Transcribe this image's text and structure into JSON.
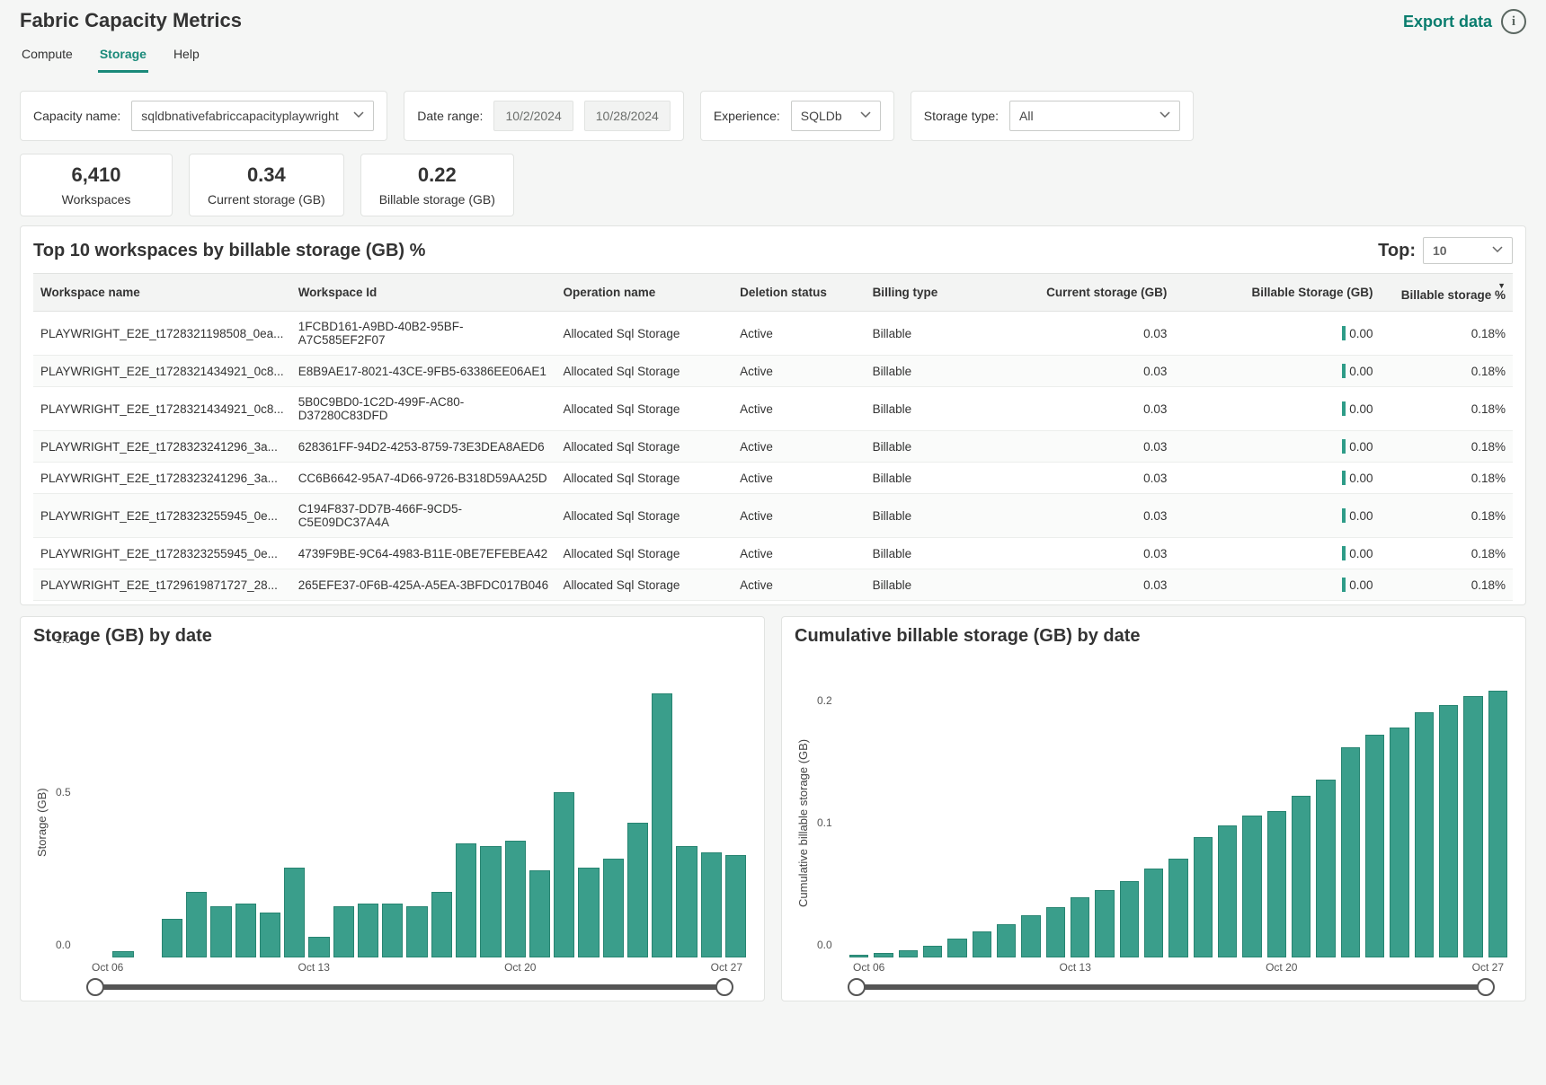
{
  "header": {
    "title": "Fabric Capacity Metrics",
    "export_label": "Export data"
  },
  "tabs": [
    {
      "label": "Compute",
      "active": false
    },
    {
      "label": "Storage",
      "active": true
    },
    {
      "label": "Help",
      "active": false
    }
  ],
  "filters": {
    "capacity_label": "Capacity name:",
    "capacity_value": "sqldbnativefabriccapacityplaywright",
    "date_label": "Date range:",
    "date_start": "10/2/2024",
    "date_end": "10/28/2024",
    "experience_label": "Experience:",
    "experience_value": "SQLDb",
    "storage_type_label": "Storage type:",
    "storage_type_value": "All"
  },
  "kpis": [
    {
      "value": "6,410",
      "label": "Workspaces"
    },
    {
      "value": "0.34",
      "label": "Current storage (GB)"
    },
    {
      "value": "0.22",
      "label": "Billable storage (GB)"
    }
  ],
  "table": {
    "title": "Top 10 workspaces by billable storage (GB) %",
    "top_label": "Top:",
    "top_value": "10",
    "columns": [
      "Workspace name",
      "Workspace Id",
      "Operation name",
      "Deletion status",
      "Billing type",
      "Current storage (GB)",
      "Billable Storage (GB)",
      "Billable storage %"
    ],
    "rows": [
      {
        "ws": "PLAYWRIGHT_E2E_t1728321198508_0ea...",
        "id": "1FCBD161-A9BD-40B2-95BF-A7C585EF2F07",
        "op": "Allocated Sql Storage",
        "del": "Active",
        "bill": "Billable",
        "cur": "0.03",
        "bs": "0.00",
        "pct": "0.18%"
      },
      {
        "ws": "PLAYWRIGHT_E2E_t1728321434921_0c8...",
        "id": "E8B9AE17-8021-43CE-9FB5-63386EE06AE1",
        "op": "Allocated Sql Storage",
        "del": "Active",
        "bill": "Billable",
        "cur": "0.03",
        "bs": "0.00",
        "pct": "0.18%"
      },
      {
        "ws": "PLAYWRIGHT_E2E_t1728321434921_0c8...",
        "id": "5B0C9BD0-1C2D-499F-AC80-D37280C83DFD",
        "op": "Allocated Sql Storage",
        "del": "Active",
        "bill": "Billable",
        "cur": "0.03",
        "bs": "0.00",
        "pct": "0.18%"
      },
      {
        "ws": "PLAYWRIGHT_E2E_t1728323241296_3a...",
        "id": "628361FF-94D2-4253-8759-73E3DEA8AED6",
        "op": "Allocated Sql Storage",
        "del": "Active",
        "bill": "Billable",
        "cur": "0.03",
        "bs": "0.00",
        "pct": "0.18%"
      },
      {
        "ws": "PLAYWRIGHT_E2E_t1728323241296_3a...",
        "id": "CC6B6642-95A7-4D66-9726-B318D59AA25D",
        "op": "Allocated Sql Storage",
        "del": "Active",
        "bill": "Billable",
        "cur": "0.03",
        "bs": "0.00",
        "pct": "0.18%"
      },
      {
        "ws": "PLAYWRIGHT_E2E_t1728323255945_0e...",
        "id": "C194F837-DD7B-466F-9CD5-C5E09DC37A4A",
        "op": "Allocated Sql Storage",
        "del": "Active",
        "bill": "Billable",
        "cur": "0.03",
        "bs": "0.00",
        "pct": "0.18%"
      },
      {
        "ws": "PLAYWRIGHT_E2E_t1728323255945_0e...",
        "id": "4739F9BE-9C64-4983-B11E-0BE7EFEBEA42",
        "op": "Allocated Sql Storage",
        "del": "Active",
        "bill": "Billable",
        "cur": "0.03",
        "bs": "0.00",
        "pct": "0.18%"
      },
      {
        "ws": "PLAYWRIGHT_E2E_t1729619871727_28...",
        "id": "265EFE37-0F6B-425A-A5EA-3BFDC017B046",
        "op": "Allocated Sql Storage",
        "del": "Active",
        "bill": "Billable",
        "cur": "0.03",
        "bs": "0.00",
        "pct": "0.18%"
      }
    ]
  },
  "chart_data": [
    {
      "type": "bar",
      "title": "Storage (GB) by date",
      "ylabel": "Storage (GB)",
      "ylim": [
        0,
        1.0
      ],
      "yticks": [
        0.0,
        0.5,
        1.0
      ],
      "categories": [
        "Oct 02",
        "Oct 03",
        "Oct 04",
        "Oct 05",
        "Oct 06",
        "Oct 07",
        "Oct 08",
        "Oct 09",
        "Oct 10",
        "Oct 11",
        "Oct 12",
        "Oct 13",
        "Oct 14",
        "Oct 15",
        "Oct 16",
        "Oct 17",
        "Oct 18",
        "Oct 19",
        "Oct 20",
        "Oct 21",
        "Oct 22",
        "Oct 23",
        "Oct 24",
        "Oct 25",
        "Oct 26",
        "Oct 27",
        "Oct 28"
      ],
      "xticks_show": [
        "Oct 06",
        "Oct 13",
        "Oct 20",
        "Oct 27"
      ],
      "values": [
        0,
        0.02,
        0,
        0.13,
        0.22,
        0.17,
        0.18,
        0.15,
        0.3,
        0.07,
        0.17,
        0.18,
        0.18,
        0.17,
        0.22,
        0.38,
        0.37,
        0.39,
        0.29,
        0.55,
        0.3,
        0.33,
        0.45,
        0.88,
        0.37,
        0.35,
        0.34
      ],
      "xlabel": ""
    },
    {
      "type": "bar",
      "title": "Cumulative billable storage (GB) by date",
      "ylabel": "Cumulative billable storage (GB)",
      "ylim": [
        0,
        0.25
      ],
      "yticks": [
        0.0,
        0.1,
        0.2
      ],
      "categories": [
        "Oct 02",
        "Oct 03",
        "Oct 04",
        "Oct 05",
        "Oct 06",
        "Oct 07",
        "Oct 08",
        "Oct 09",
        "Oct 10",
        "Oct 11",
        "Oct 12",
        "Oct 13",
        "Oct 14",
        "Oct 15",
        "Oct 16",
        "Oct 17",
        "Oct 18",
        "Oct 19",
        "Oct 20",
        "Oct 21",
        "Oct 22",
        "Oct 23",
        "Oct 24",
        "Oct 25",
        "Oct 26",
        "Oct 27",
        "Oct 28"
      ],
      "xticks_show": [
        "Oct 06",
        "Oct 13",
        "Oct 20",
        "Oct 27"
      ],
      "values": [
        0.002,
        0.004,
        0.006,
        0.01,
        0.016,
        0.022,
        0.028,
        0.035,
        0.042,
        0.05,
        0.056,
        0.064,
        0.074,
        0.082,
        0.1,
        0.11,
        0.118,
        0.122,
        0.135,
        0.148,
        0.175,
        0.186,
        0.192,
        0.204,
        0.21,
        0.218,
        0.222
      ],
      "xlabel": ""
    }
  ]
}
